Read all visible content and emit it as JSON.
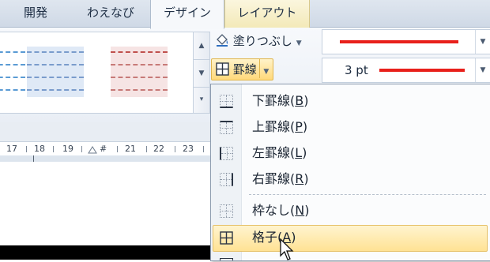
{
  "tabs": [
    {
      "label": "開発"
    },
    {
      "label": "わえなび"
    },
    {
      "label": "デザイン"
    },
    {
      "label": "レイアウト"
    }
  ],
  "ribbon": {
    "shading_label": "塗りつぶし",
    "borders_label": "罫線",
    "pen_weight": "3 pt",
    "pen_color": "#e8201b"
  },
  "ruler": {
    "numbers": [
      "17",
      "18",
      "19",
      "#",
      "21",
      "22",
      "23"
    ]
  },
  "menu": {
    "items": [
      {
        "label_pre": "下罫線(",
        "key": "B",
        "label_post": ")",
        "icon": "bottom-border-icon"
      },
      {
        "label_pre": "上罫線(",
        "key": "P",
        "label_post": ")",
        "icon": "top-border-icon"
      },
      {
        "label_pre": "左罫線(",
        "key": "L",
        "label_post": ")",
        "icon": "left-border-icon"
      },
      {
        "label_pre": "右罫線(",
        "key": "R",
        "label_post": ")",
        "icon": "right-border-icon"
      },
      {
        "label_pre": "枠なし(",
        "key": "N",
        "label_post": ")",
        "icon": "no-border-icon"
      },
      {
        "label_pre": "格子(",
        "key": "A",
        "label_post": ")",
        "icon": "all-borders-icon",
        "highlighted": true
      }
    ]
  },
  "colors": {
    "accent_highlight": "#ffe294",
    "context_tab": "#f3e9b8"
  }
}
